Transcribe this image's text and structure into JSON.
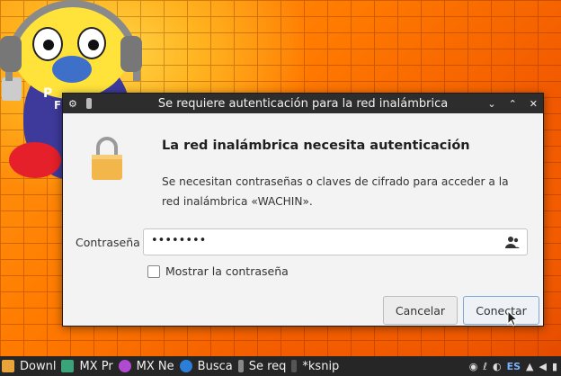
{
  "desktop": {
    "wallpaper_text_1": "P",
    "wallpaper_text_2": "F"
  },
  "dialog": {
    "title": "Se requiere autenticación para la red inalámbrica",
    "titlebar_icons": {
      "menu": "gear-icon",
      "pin": "pin-icon",
      "minimize": "minimize-icon",
      "maximize": "maximize-icon",
      "close": "close-icon"
    },
    "heading": "La red inalámbrica necesita autenticación",
    "description": "Se necesitan contraseñas o claves de cifrado para acceder a la red inalámbrica «WACHIN».",
    "password_label": "Contraseña",
    "password_value": "••••••••",
    "show_password_label": "Mostrar la contraseña",
    "show_password_checked": false,
    "cancel_label": "Cancelar",
    "connect_label": "Conectar",
    "accent_color": "#7fa7d6"
  },
  "taskbar": {
    "items": [
      {
        "label": "Downl",
        "icon": "folder-icon",
        "color": "#e8a33a"
      },
      {
        "label": "MX Pr",
        "icon": "mx-icon",
        "color": "#3aa37a"
      },
      {
        "label": "MX Ne",
        "icon": "gear-icon",
        "color": "#b04ad0"
      },
      {
        "label": "Busca",
        "icon": "search-icon",
        "color": "#2b7fd8"
      },
      {
        "label": "Se req",
        "icon": "pin-icon",
        "color": "#888888"
      },
      {
        "label": "*ksnip",
        "icon": "scissors-icon",
        "color": "#555555"
      }
    ],
    "tray": {
      "lang": "ES",
      "icons": [
        "clipboard-icon",
        "network-icon",
        "bluetooth-icon",
        "volume-icon",
        "battery-icon",
        "wifi-icon"
      ]
    }
  }
}
